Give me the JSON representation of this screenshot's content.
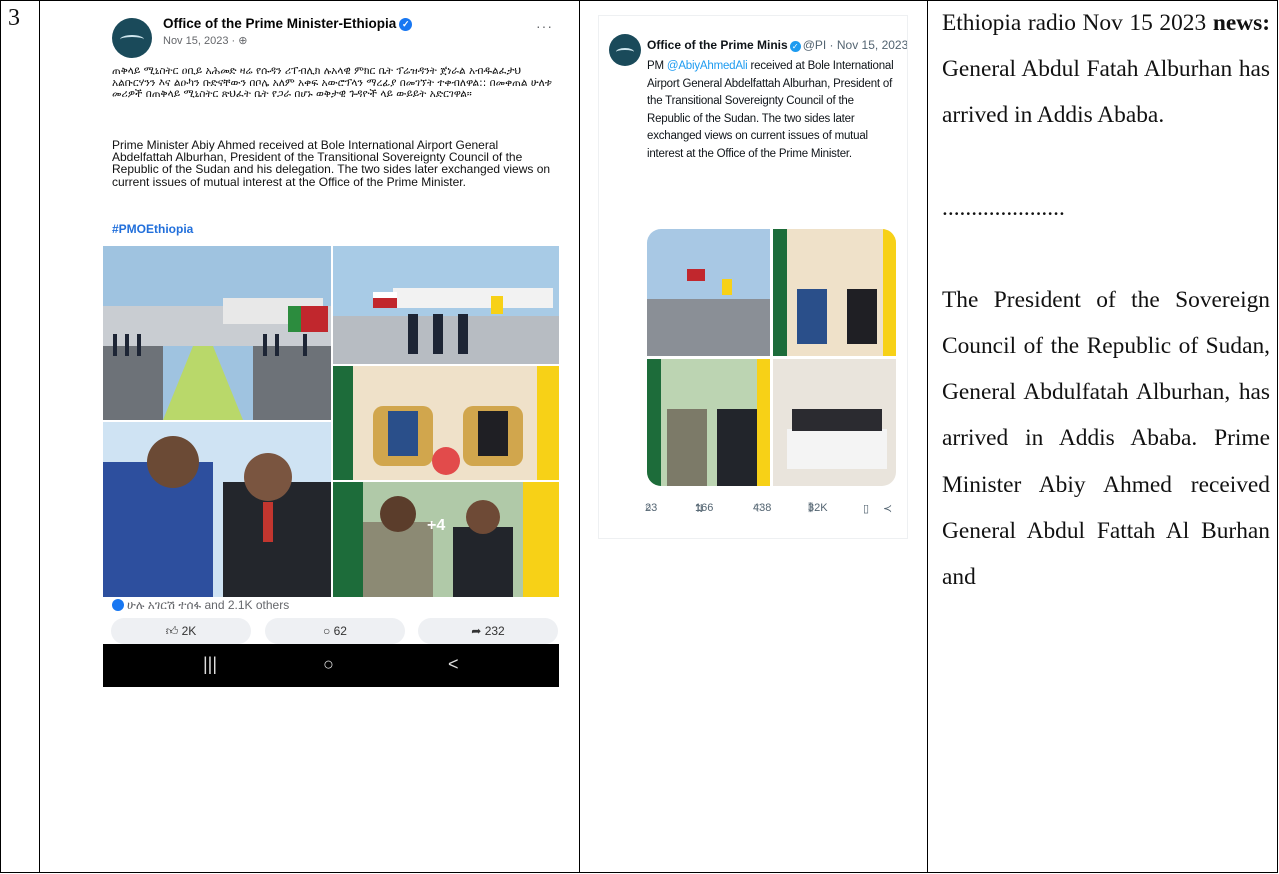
{
  "row_number": "3",
  "facebook_post": {
    "page_name": "Office of the Prime Minister-Ethiopia",
    "date": "Nov 15, 2023 · ",
    "more_icon": "more-dots-icon",
    "amharic_text": "ጠቅላይ ሚኒስትር ዐቢይ አሕመድ ዛሬ የሱዳን ሪፐብሊክ ሉአላዊ ምክር ቤት ፕሬዝዳንት ጀነራል አብዱልፈታህ አልቡርሃንን እና ልዑካን ቡድናቸውን በቦሌ አለም አቀፍ አውሮፕላን ማረፊያ በመገኘት ተቀብለዋል:: በመቀጠል ሁለቱ መሪዎች በጠቅላይ ሚኒስትር ጽህፈት ቤት የጋራ በሆኑ ወቅታዊ ጉዳዮች ላይ ውይይት አድርገዋል።",
    "english_text": "Prime Minister Abiy Ahmed received at Bole International Airport General Abdelfattah Alburhan, President of the Transitional Sovereignty Council of the Republic of the Sudan and his delegation. The two sides later exchanged views on current issues of mutual interest at the Office of the Prime Minister.",
    "hashtag": "#PMOEthiopia",
    "more_photos": "+4",
    "reactions": "ሁሉ አገርሽ ተሰፋ and 2.1K others",
    "likes": "2K",
    "comments": "62",
    "shares": "232",
    "nav_recents": "|||",
    "nav_home": "○",
    "nav_back": "<"
  },
  "x_post": {
    "display_name": "Office of the Prime Minis",
    "handle_date": "@PI · Nov 15, 2023",
    "more": "···",
    "text_prefix": "PM ",
    "mention": "@AbiyAhmedAli",
    "text_rest": " received at Bole International Airport General Abdelfattah Alburhan, President of the Transitional Sovereignty Council of the Republic of the Sudan. The two sides later exchanged views on current issues of mutual interest at the Office of the Prime Minister.",
    "replies": "23",
    "reposts": "166",
    "likes": "438",
    "views": "32K"
  },
  "description": {
    "p1_start": "Ethiopia radio Nov 15 2023 ",
    "p1_bold": "news:",
    "p1_end": " General Abdul Fatah Alburhan has arrived in Addis Ababa.",
    "separator": ".....................",
    "p2": "The President of the Sovereign Council of the Republic of Sudan, General Abdulfatah Alburhan, has arrived in Addis Ababa. Prime Minister Abiy Ahmed received General Abdul Fattah Al Burhan and"
  }
}
